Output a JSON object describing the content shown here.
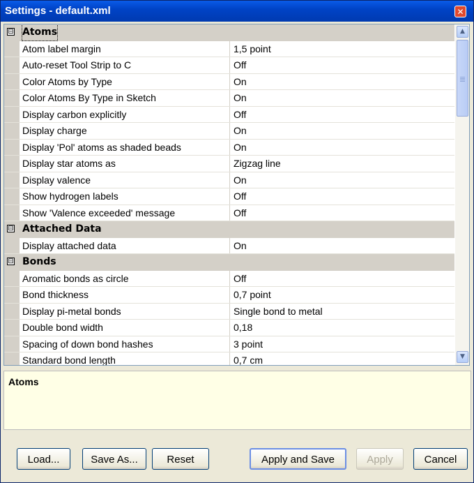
{
  "window": {
    "title": "Settings - default.xml",
    "close_glyph": "✕"
  },
  "grid": {
    "rows": [
      {
        "type": "category",
        "label": "Atoms",
        "toggle": "⊟"
      },
      {
        "type": "property",
        "name": "Atom label margin",
        "value": "1,5 point"
      },
      {
        "type": "property",
        "name": "Auto-reset Tool Strip to C",
        "value": "Off"
      },
      {
        "type": "property",
        "name": "Color Atoms by Type",
        "value": "On"
      },
      {
        "type": "property",
        "name": "Color Atoms By Type in Sketch",
        "value": "On"
      },
      {
        "type": "property",
        "name": "Display carbon explicitly",
        "value": "Off"
      },
      {
        "type": "property",
        "name": "Display charge",
        "value": "On"
      },
      {
        "type": "property",
        "name": "Display 'Pol' atoms as shaded beads",
        "value": "On"
      },
      {
        "type": "property",
        "name": "Display star atoms as",
        "value": "Zigzag line"
      },
      {
        "type": "property",
        "name": "Display valence",
        "value": "On"
      },
      {
        "type": "property",
        "name": "Show hydrogen labels",
        "value": "Off"
      },
      {
        "type": "property",
        "name": "Show 'Valence exceeded' message",
        "value": "Off"
      },
      {
        "type": "category",
        "label": "Attached Data",
        "toggle": "⊟"
      },
      {
        "type": "property",
        "name": "Display attached data",
        "value": "On"
      },
      {
        "type": "category",
        "label": "Bonds",
        "toggle": "⊟"
      },
      {
        "type": "property",
        "name": "Aromatic bonds as circle",
        "value": "Off"
      },
      {
        "type": "property",
        "name": "Bond thickness",
        "value": "0,7 point"
      },
      {
        "type": "property",
        "name": "Display pi-metal bonds",
        "value": "Single bond to metal"
      },
      {
        "type": "property",
        "name": "Double bond width",
        "value": "0,18"
      },
      {
        "type": "property",
        "name": "Spacing of down bond hashes",
        "value": "3 point"
      },
      {
        "type": "property",
        "name": "Standard bond length",
        "value": "0,7 cm"
      }
    ]
  },
  "scrollbar": {
    "up_glyph": "▲",
    "down_glyph": "▼"
  },
  "description": {
    "title": "Atoms"
  },
  "buttons": {
    "load": "Load...",
    "save_as": "Save As...",
    "reset": "Reset",
    "apply_and_save": "Apply and Save",
    "apply": "Apply",
    "cancel": "Cancel"
  },
  "colors": {
    "titlebar": "#0043c6",
    "category_bg": "#d4d0c8",
    "description_bg": "#ffffe6"
  }
}
